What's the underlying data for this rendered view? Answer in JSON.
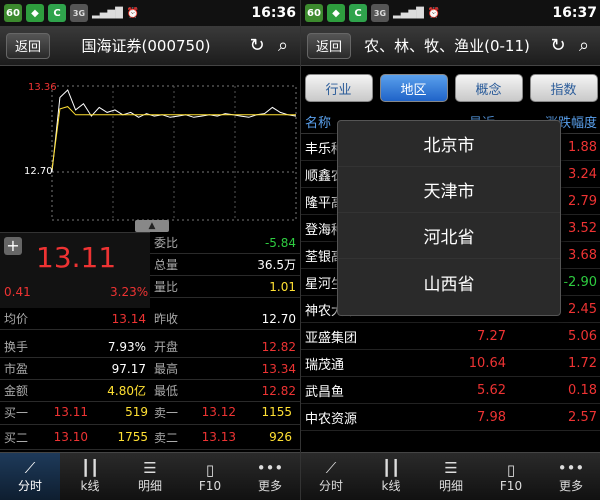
{
  "left": {
    "status": {
      "time": "16:36",
      "battery": "60",
      "icons": [
        "battery-icon",
        "c-app-icon",
        "signal-icon",
        "alarm-icon"
      ],
      "net_label": "3G"
    },
    "header": {
      "back_label": "返回",
      "title": "国海证券(000750)"
    },
    "chart": {
      "top_label": "13.36",
      "mid_label": "12.70",
      "price_line": [
        12.7,
        13.3,
        13.36,
        13.2,
        13.25,
        13.15,
        13.22,
        13.18,
        13.2,
        13.16,
        13.18,
        13.14,
        13.17,
        13.15,
        13.16,
        13.14,
        13.15,
        13.16,
        13.14,
        13.15,
        13.16,
        13.15,
        13.17,
        13.16,
        13.15,
        13.14,
        13.16,
        13.17,
        13.22,
        13.18,
        13.16,
        13.15
      ]
    },
    "quote": {
      "price": "13.11",
      "change": "0.41",
      "change_pct": "3.23%"
    },
    "kv": [
      {
        "k": "委比",
        "v": "-5.84",
        "color": "#2ecc40"
      },
      {
        "k": "总量",
        "v": "36.5万",
        "color": "#ffffff"
      },
      {
        "k": "量比",
        "v": "1.01",
        "color": "#ffe033"
      }
    ],
    "stats": [
      [
        {
          "k": "均价",
          "v": "13.14",
          "color": "#e33"
        },
        {
          "k": "昨收",
          "v": "12.70",
          "color": "#ffffff"
        }
      ],
      [
        {
          "k": "换手",
          "v": "7.93%",
          "color": "#ffffff"
        },
        {
          "k": "开盘",
          "v": "12.82",
          "color": "#e33"
        }
      ],
      [
        {
          "k": "市盈",
          "v": "97.17",
          "color": "#ffffff"
        },
        {
          "k": "最高",
          "v": "13.34",
          "color": "#e33"
        }
      ],
      [
        {
          "k": "金额",
          "v": "4.80亿",
          "color": "#ffffff"
        },
        {
          "k": "最低",
          "v": "12.82",
          "color": "#e33"
        }
      ]
    ],
    "orders": [
      {
        "b_label": "买一",
        "b_price": "13.11",
        "b_vol": "519",
        "s_label": "卖一",
        "s_price": "13.12",
        "s_vol": "1155"
      },
      {
        "b_label": "买二",
        "b_price": "13.10",
        "b_vol": "1755",
        "s_label": "卖二",
        "s_price": "13.13",
        "s_vol": "926"
      }
    ],
    "nav": [
      {
        "label": "分时",
        "icon": "line-chart-icon",
        "glyph": "📈",
        "active": true
      },
      {
        "label": "k线",
        "icon": "candlestick-icon",
        "glyph": "┃",
        "active": false
      },
      {
        "label": "明细",
        "icon": "list-icon",
        "glyph": "☰",
        "active": false
      },
      {
        "label": "F10",
        "icon": "document-icon",
        "glyph": "▯",
        "active": false
      },
      {
        "label": "更多",
        "icon": "more-icon",
        "glyph": "•••",
        "active": false
      }
    ]
  },
  "right": {
    "status": {
      "time": "16:37",
      "battery": "60",
      "net_label": "3G"
    },
    "header": {
      "back_label": "返回",
      "title": "农、林、牧、渔业(0-11)"
    },
    "tabs": [
      {
        "label": "行业",
        "active": false
      },
      {
        "label": "地区",
        "active": true
      },
      {
        "label": "概念",
        "active": false
      },
      {
        "label": "指数",
        "active": false
      }
    ],
    "list_header": {
      "name": "名称",
      "last": "最近",
      "chg": "涨跌幅度"
    },
    "rows": [
      {
        "name": "丰乐种业",
        "last": "",
        "chg": "1.88",
        "color": "#e33"
      },
      {
        "name": "顺鑫农业",
        "last": "",
        "chg": "3.24",
        "color": "#e33"
      },
      {
        "name": "隆平高科",
        "last": "",
        "chg": "2.79",
        "color": "#e33"
      },
      {
        "name": "登海种业",
        "last": "",
        "chg": "3.52",
        "color": "#e33"
      },
      {
        "name": "荃银高科",
        "last": "",
        "chg": "3.68",
        "color": "#e33"
      },
      {
        "name": "星河生物",
        "last": "",
        "chg": "-2.90",
        "color": "#2ecc40"
      },
      {
        "name": "神农大丰",
        "last": "",
        "chg": "2.45",
        "color": "#e33"
      },
      {
        "name": "亚盛集团",
        "last": "7.27",
        "chg": "5.06",
        "color": "#e33"
      },
      {
        "name": "瑞茂通",
        "last": "10.64",
        "chg": "1.72",
        "color": "#e33"
      },
      {
        "name": "武昌鱼",
        "last": "5.62",
        "chg": "0.18",
        "color": "#e33"
      },
      {
        "name": "中农资源",
        "last": "7.98",
        "chg": "2.57",
        "color": "#e33"
      }
    ],
    "dropdown": [
      "北京市",
      "天津市",
      "河北省",
      "山西省"
    ],
    "nav": [
      {
        "label": "分时",
        "icon": "line-chart-icon",
        "glyph": "📈"
      },
      {
        "label": "k线",
        "icon": "candlestick-icon",
        "glyph": "┃"
      },
      {
        "label": "明细",
        "icon": "list-icon",
        "glyph": "☰"
      },
      {
        "label": "F10",
        "icon": "document-icon",
        "glyph": "▯"
      },
      {
        "label": "更多",
        "icon": "more-icon",
        "glyph": "•••"
      }
    ]
  }
}
